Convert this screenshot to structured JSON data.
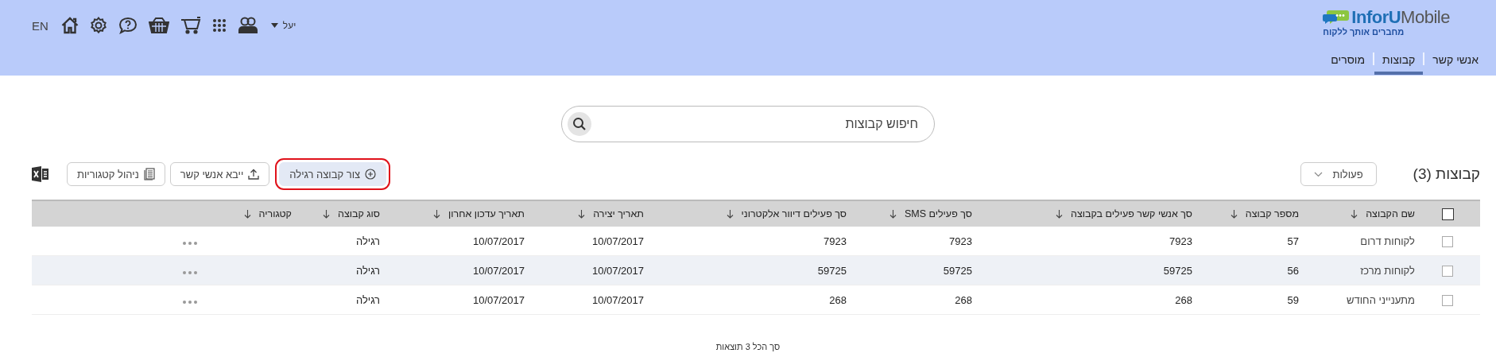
{
  "header": {
    "language": "EN",
    "user": "יעל",
    "logo": {
      "name_1": "InforU",
      "name_2": "Mobile",
      "tagline": "מחברים אותך ללקוח"
    }
  },
  "tabs": [
    {
      "label": "אנשי קשר",
      "selected": false
    },
    {
      "label": "קבוצות",
      "selected": true
    },
    {
      "label": "מוסרים",
      "selected": false
    }
  ],
  "search": {
    "placeholder": "חיפוש קבוצות"
  },
  "title": "קבוצות (3)",
  "actions_menu": {
    "label": "פעולות"
  },
  "toolbar": [
    {
      "label": "צור קבוצה רגילה",
      "kind": "create",
      "highlighted": true
    },
    {
      "label": "ייבא אנשי קשר",
      "kind": "import",
      "highlighted": false
    },
    {
      "label": "ניהול קטגוריות",
      "kind": "categories",
      "highlighted": false
    }
  ],
  "table": {
    "select_all": false,
    "columns": [
      "שם הקבוצה",
      "מספר קבוצה",
      "סך אנשי קשר פעילים בקבוצה",
      "סך פעילים SMS",
      "סך פעילים דיוור אלקטרוני",
      "תאריך יצירה",
      "תאריך עדכון אחרון",
      "סוג קבוצה",
      "קטגוריה"
    ],
    "rows": [
      {
        "selected": false,
        "cells": [
          "לקוחות דרום",
          "57",
          "7923",
          "7923",
          "7923",
          "10/07/2017",
          "10/07/2017",
          "רגילה",
          ""
        ]
      },
      {
        "selected": false,
        "cells": [
          "לקוחות מרכז",
          "56",
          "59725",
          "59725",
          "59725",
          "10/07/2017",
          "10/07/2017",
          "רגילה",
          ""
        ]
      },
      {
        "selected": false,
        "cells": [
          "מתענייני החודש",
          "59",
          "268",
          "268",
          "268",
          "10/07/2017",
          "10/07/2017",
          "רגילה",
          ""
        ]
      }
    ]
  },
  "footer": "סך הכל 3 תוצאות"
}
